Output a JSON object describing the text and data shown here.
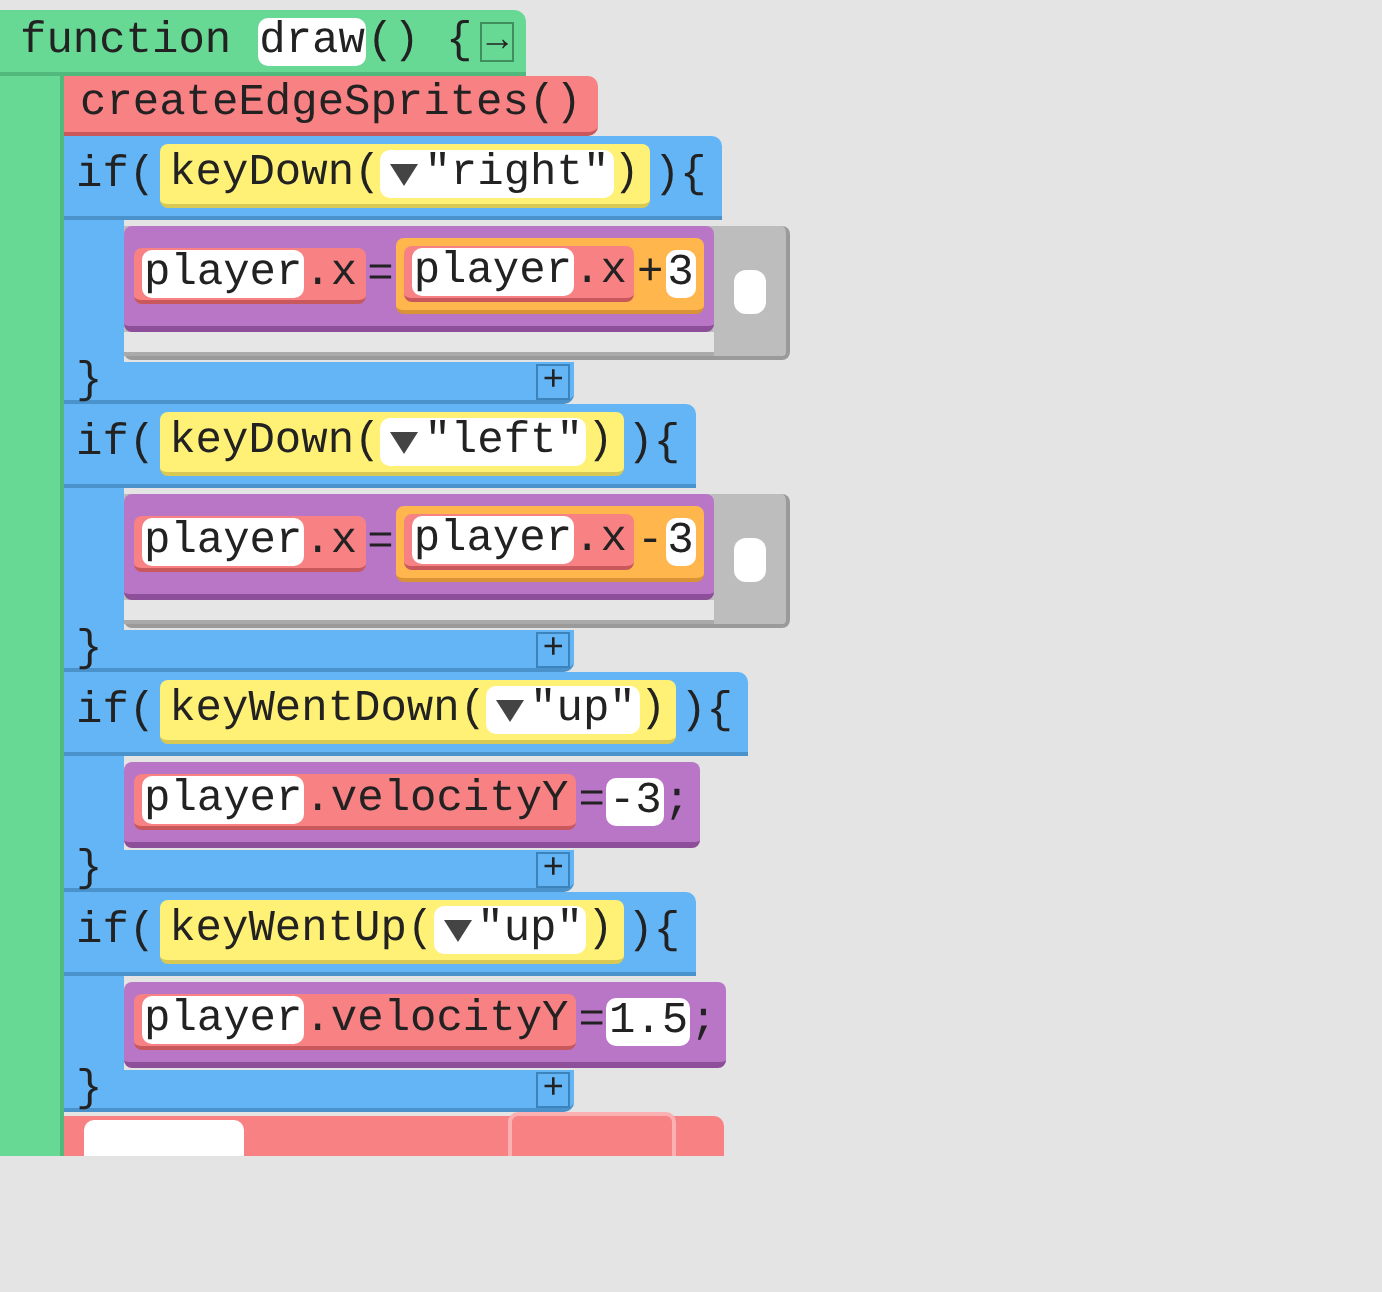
{
  "function": {
    "keyword": "function",
    "name": "draw",
    "parens": "() {",
    "collapse_button": "→"
  },
  "statements": [
    {
      "kind": "call",
      "text": "createEdgeSprites()"
    },
    {
      "kind": "if",
      "open": "if(",
      "close": "){",
      "end": "}",
      "add_button": "+",
      "condition": {
        "kind": "call",
        "name": "keyDown",
        "open": "(",
        "dropdown": true,
        "arg": "\"right\"",
        "close": ")"
      },
      "body": [
        {
          "kind": "assign",
          "drop_placeholder": true,
          "target": {
            "kind": "var_prop",
            "object": "player",
            "property": ".x"
          },
          "operator": "=",
          "value": {
            "kind": "binop",
            "left": {
              "kind": "var_prop",
              "object": "player",
              "property": ".x"
            },
            "operator": "+",
            "right": {
              "kind": "literal",
              "text": "3"
            }
          }
        }
      ]
    },
    {
      "kind": "if",
      "open": "if(",
      "close": "){",
      "end": "}",
      "add_button": "+",
      "condition": {
        "kind": "call",
        "name": "keyDown",
        "open": "(",
        "dropdown": true,
        "arg": "\"left\"",
        "close": ")"
      },
      "body": [
        {
          "kind": "assign",
          "drop_placeholder": true,
          "target": {
            "kind": "var_prop",
            "object": "player",
            "property": ".x"
          },
          "operator": "=",
          "value": {
            "kind": "binop",
            "left": {
              "kind": "var_prop",
              "object": "player",
              "property": ".x"
            },
            "operator": "-",
            "right": {
              "kind": "literal",
              "text": "3"
            }
          }
        }
      ]
    },
    {
      "kind": "if",
      "open": "if(",
      "close": "){",
      "end": "}",
      "add_button": "+",
      "condition": {
        "kind": "call",
        "name": "keyWentDown",
        "open": "(",
        "dropdown": true,
        "arg": "\"up\"",
        "close": ")"
      },
      "body": [
        {
          "kind": "assign",
          "drop_placeholder": false,
          "target": {
            "kind": "var_prop",
            "object": "player",
            "property": ".velocityY"
          },
          "operator": "=",
          "value": {
            "kind": "literal",
            "text": "-3"
          },
          "terminator": ";"
        }
      ]
    },
    {
      "kind": "if",
      "open": "if(",
      "close": "){",
      "end": "}",
      "add_button": "+",
      "condition": {
        "kind": "call",
        "name": "keyWentUp",
        "open": "(",
        "dropdown": true,
        "arg": "\"up\"",
        "close": ")"
      },
      "body": [
        {
          "kind": "assign",
          "drop_placeholder": false,
          "target": {
            "kind": "var_prop",
            "object": "player",
            "property": ".velocityY"
          },
          "operator": "=",
          "value": {
            "kind": "literal",
            "text": "1.5"
          },
          "terminator": ";"
        }
      ]
    },
    {
      "kind": "partial"
    }
  ]
}
